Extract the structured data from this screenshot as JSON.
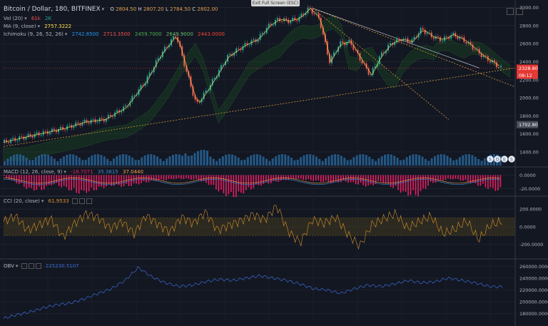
{
  "fullscreen_hint": "Exit Full Screen (ESC)",
  "main": {
    "title": "Bitcoin / Dollar, 180, BITFINEX",
    "ohlc": {
      "o": "2804.50",
      "h": "2807.20",
      "l": "2784.50",
      "c": "2802.00"
    },
    "vol_label": "Vol (20)",
    "vol_values": [
      "61k",
      "2K"
    ],
    "ma_label": "MA (9, close)",
    "ma_value": "2757.3222",
    "ichimoku_label": "Ichimoku (9, 26, 52, 26)",
    "ichimoku_values": [
      "2742.8500",
      "2713.3500",
      "2459.7000",
      "2649.9000",
      "2443.0000"
    ],
    "badge_price": "2328.80",
    "badge_time": "08:12",
    "badge_level": "1702.80",
    "markers": [
      "S",
      "D",
      "E",
      "S"
    ]
  },
  "macd": {
    "label": "MACD (12, 26, close, 9)",
    "values": [
      "-18.7071",
      "35.3615",
      "37.0440"
    ]
  },
  "cci": {
    "label": "CCI (20, close)",
    "value": "61.9533"
  },
  "obv": {
    "label": "OBV",
    "value": "225230.5107"
  },
  "colors": {
    "background": "#131722",
    "up": "#26a69a",
    "down": "#ef5350",
    "price_line": "#ff5252",
    "ma": "#ffe14d",
    "volume": "#2a6fa8",
    "macd_hist": "#e91e63",
    "macd_line": "#3d8bd9",
    "signal": "#f6a34a",
    "cci": "#d8952a",
    "obv": "#3a6bd4",
    "trendline": "#d59a3a"
  },
  "chart_data": [
    {
      "type": "candlestick",
      "title": "Bitcoin / Dollar, 180, BITFINEX",
      "ylim": [
        1250,
        3020
      ],
      "yticks": [
        3000,
        2800,
        2600,
        2400,
        2200,
        2000,
        1800,
        1600,
        1400
      ],
      "ytick_labels": [
        "3000.00",
        "2800.00",
        "2600.00",
        "2400.00",
        "2200.00",
        "2000.00",
        "1800.00",
        "1600.00",
        "1400.00"
      ],
      "price_trend": {
        "x": [
          0,
          4,
          8,
          12,
          16,
          20,
          24,
          28,
          31,
          34,
          36,
          38,
          40,
          42,
          44,
          46,
          48,
          50,
          52,
          54,
          56,
          58,
          60,
          62,
          64,
          66,
          68,
          70,
          72,
          74,
          76,
          78,
          80,
          82,
          84,
          86,
          88,
          90,
          92,
          94,
          96,
          97.5
        ],
        "y": [
          1505,
          1560,
          1610,
          1660,
          1730,
          1760,
          1890,
          2180,
          2480,
          2700,
          2300,
          1920,
          2080,
          2260,
          2450,
          2530,
          2600,
          2650,
          2790,
          2870,
          2850,
          2880,
          2990,
          2880,
          2400,
          2600,
          2620,
          2430,
          2250,
          2470,
          2600,
          2650,
          2620,
          2760,
          2680,
          2640,
          2700,
          2650,
          2560,
          2460,
          2390,
          2328
        ]
      },
      "price_line": 2328.8,
      "ma": {
        "label": "MA (9, close)",
        "value": 2757.3222
      },
      "volume_axis_labels": [],
      "trendlines": "dashed orange"
    },
    {
      "type": "bar",
      "title": "MACD (12, 26, close, 9)",
      "ylim": [
        -30,
        10
      ],
      "yticks": [
        0,
        -20
      ],
      "ytick_labels": [
        "0.0000",
        "-20.0000"
      ],
      "histogram_depth": [
        2,
        12,
        22,
        24,
        14,
        20,
        28,
        26,
        20,
        16,
        18,
        14,
        10,
        8,
        6,
        6,
        8,
        16,
        30,
        34,
        24,
        16,
        12,
        8,
        6,
        8,
        10,
        12,
        10,
        14,
        18,
        10,
        20,
        30,
        32,
        14,
        8,
        6,
        10,
        16,
        22,
        26
      ]
    },
    {
      "type": "line",
      "title": "CCI (20, close)",
      "ylim": [
        -360,
        340
      ],
      "yticks": [
        200,
        0,
        -200
      ],
      "ytick_labels": [
        "200.0000",
        "0.0000",
        "-200.0000"
      ],
      "band": [
        -100,
        100
      ],
      "y": [
        60,
        120,
        -40,
        20,
        90,
        -120,
        40,
        150,
        100,
        -20,
        60,
        -80,
        130,
        30,
        -60,
        110,
        40,
        170,
        -40,
        20,
        70,
        140,
        80,
        240,
        -60,
        -180,
        80,
        40,
        110,
        -90,
        -220,
        20,
        90,
        150,
        -20,
        60,
        120,
        -80,
        -30,
        70,
        -150,
        20,
        61
      ]
    },
    {
      "type": "line",
      "title": "OBV",
      "ylim": [
        165000,
        270000
      ],
      "yticks": [
        260000,
        240000,
        220000,
        200000,
        180000
      ],
      "ytick_labels": [
        "260000.0000",
        "240000.0000",
        "220000.0000",
        "200000.0000",
        "180000.0000"
      ],
      "y": [
        172000,
        178000,
        183000,
        190000,
        195000,
        198000,
        205000,
        214000,
        222000,
        236000,
        258000,
        242000,
        232000,
        226000,
        228000,
        234000,
        238000,
        236000,
        240000,
        244000,
        240000,
        236000,
        230000,
        222000,
        220000,
        214000,
        222000,
        228000,
        226000,
        230000,
        236000,
        232000,
        234000,
        240000,
        236000,
        232000,
        226000,
        225230
      ]
    }
  ]
}
